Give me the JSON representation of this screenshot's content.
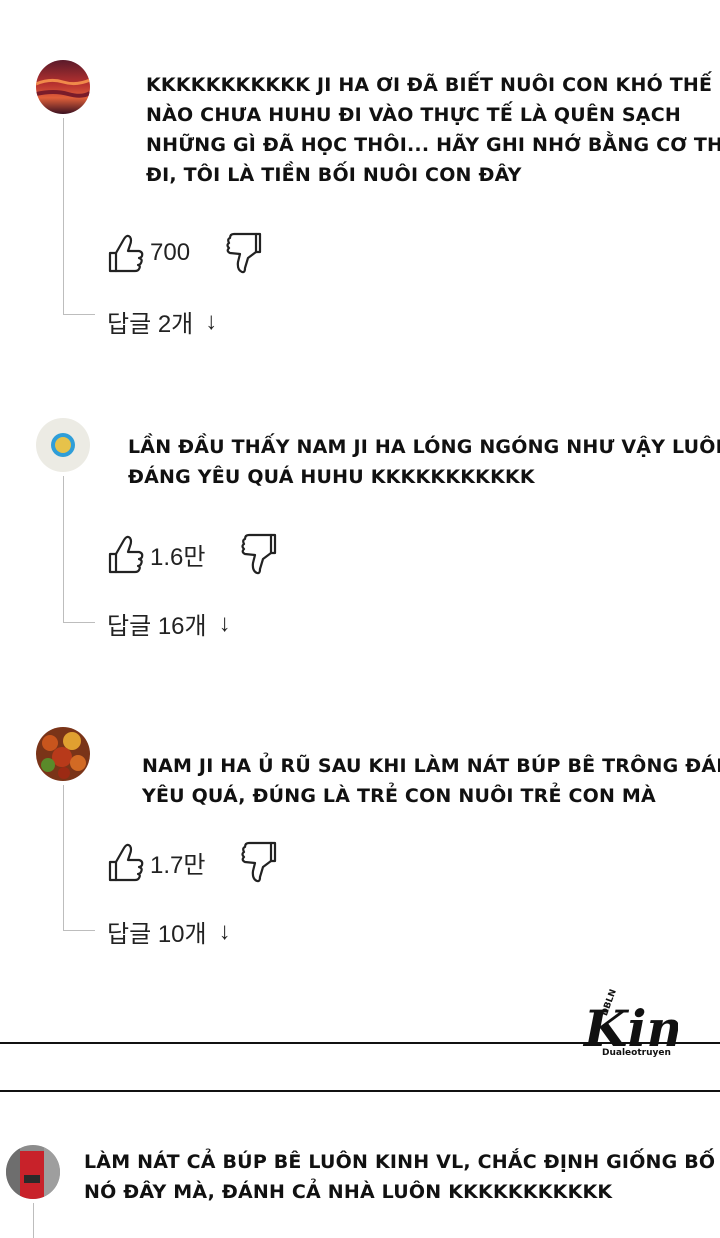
{
  "comments": [
    {
      "text_lines": [
        "KKKKKKKKKKK JI HA ƠI ĐÃ BIẾT NUÔI CON KHÓ THẾ",
        "NÀO CHƯA HUHU ĐI VÀO THỰC TẾ LÀ QUÊN SẠCH",
        "NHỮNG GÌ ĐÃ HỌC THÔI... HÃY GHI NHỚ BẰNG CƠ THỂ",
        "ĐI, TÔI LÀ TIỀN BỐI NUÔI CON ĐÂY"
      ],
      "likes": "700",
      "replies_label": "답글 2개",
      "arrow": "↓"
    },
    {
      "text_lines": [
        "LẦN ĐẦU THẤY NAM JI HA LÓNG NGÓNG NHƯ VẬY LUÔN,",
        "ĐÁNG YÊU QUÁ HUHU KKKKKKKKKKK"
      ],
      "likes": "1.6만",
      "replies_label": "답글 16개",
      "arrow": "↓"
    },
    {
      "text_lines": [
        "NAM JI HA Ủ RŨ SAU KHI LÀM NÁT BÚP BÊ TRÔNG ĐÁNG",
        "YÊU QUÁ, ĐÚNG LÀ TRẺ CON NUÔI TRẺ CON MÀ"
      ],
      "likes": "1.7만",
      "replies_label": "답글 10개",
      "arrow": "↓"
    },
    {
      "text_lines": [
        "LÀM NÁT CẢ BÚP BÊ LUÔN KINH VL, CHẮC ĐỊNH GIỐNG BỐ",
        "NÓ ĐÂY MÀ, ĐÁNH CẢ NHÀ LUÔN KKKKKKKKKKK"
      ]
    }
  ],
  "watermark": {
    "main": "Kim",
    "top": "DBLN",
    "bottom": "Dualeotruyen"
  },
  "icons": {
    "like": "thumbs-up-icon",
    "dislike": "thumbs-down-icon"
  }
}
